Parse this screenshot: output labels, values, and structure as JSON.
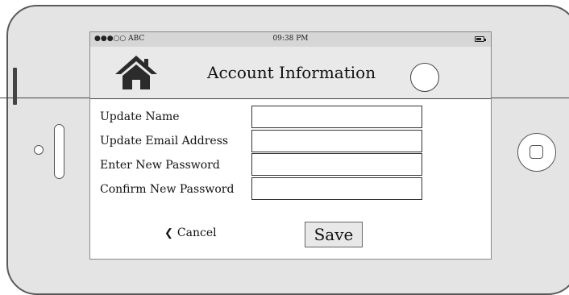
{
  "status_bar": {
    "carrier": "●●●○○ ABC",
    "time": "09:38 PM",
    "battery_icon": "battery-icon"
  },
  "header": {
    "title": "Account Information",
    "home_icon": "home-icon",
    "avatar_icon": "avatar-placeholder"
  },
  "form": {
    "fields": [
      {
        "label": "Update Name",
        "value": ""
      },
      {
        "label": "Update Email Address",
        "value": ""
      },
      {
        "label": "Enter New Password",
        "value": ""
      },
      {
        "label": "Confirm New Password",
        "value": ""
      }
    ]
  },
  "actions": {
    "cancel_label": "Cancel",
    "cancel_icon": "chevron-left-icon",
    "save_label": "Save"
  }
}
